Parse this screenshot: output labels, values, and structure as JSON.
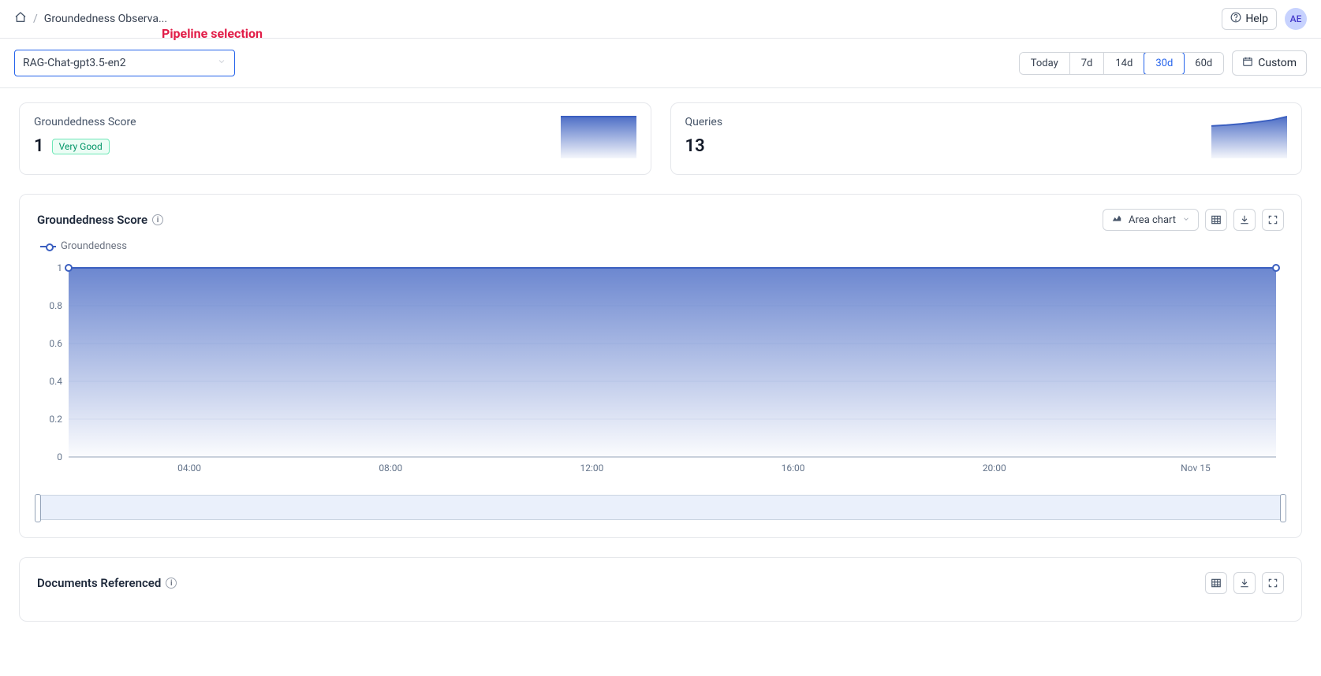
{
  "breadcrumb": {
    "current": "Groundedness Observa..."
  },
  "annotation": "Pipeline selection",
  "help_label": "Help",
  "avatar_initials": "AE",
  "pipeline": {
    "selected": "RAG-Chat-gpt3.5-en2"
  },
  "time_range": {
    "options": [
      "Today",
      "7d",
      "14d",
      "30d",
      "60d"
    ],
    "selected_index": 3,
    "custom_label": "Custom"
  },
  "summary_cards": {
    "groundedness": {
      "title": "Groundedness Score",
      "value": "1",
      "badge": "Very Good"
    },
    "queries": {
      "title": "Queries",
      "value": "13"
    }
  },
  "chart_panel": {
    "title": "Groundedness Score",
    "legend_label": "Groundedness",
    "chart_type_label": "Area chart"
  },
  "docs_panel": {
    "title": "Documents Referenced"
  },
  "chart_data": {
    "type": "area",
    "title": "Groundedness Score",
    "xlabel": "",
    "ylabel": "",
    "ylim": [
      0,
      1
    ],
    "y_ticks": [
      0,
      0.2,
      0.4,
      0.6,
      0.8,
      1
    ],
    "x_ticks": [
      "04:00",
      "08:00",
      "12:00",
      "16:00",
      "20:00",
      "Nov 15"
    ],
    "series": [
      {
        "name": "Groundedness",
        "values": [
          1,
          1,
          1,
          1,
          1,
          1,
          1
        ]
      }
    ],
    "color": "#3b5fc0"
  },
  "mini_charts": {
    "groundedness_values": [
      1,
      1,
      1,
      1,
      1,
      1
    ],
    "queries_values": [
      0.78,
      0.8,
      0.83,
      0.87,
      0.92,
      1.0
    ]
  }
}
